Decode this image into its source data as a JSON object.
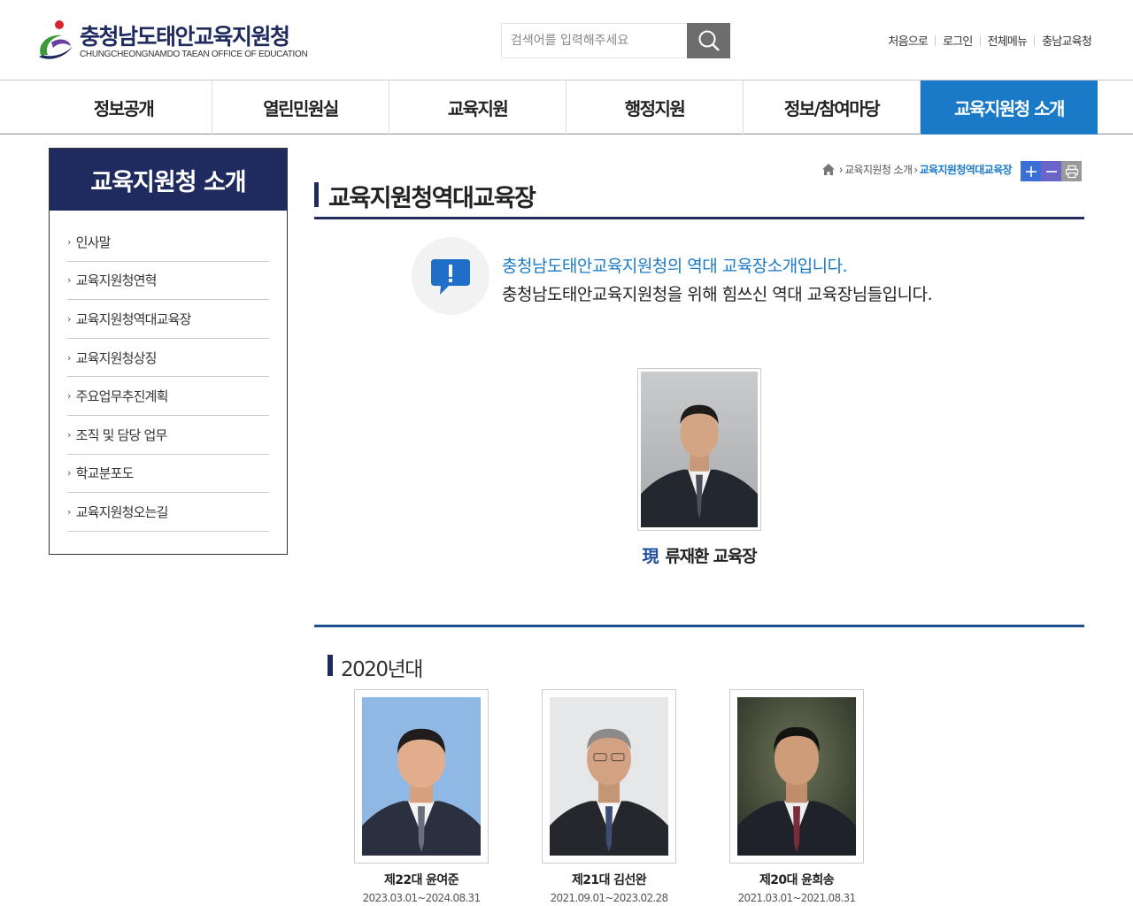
{
  "header": {
    "logo_title": "충청남도태안교육지원청",
    "logo_subtitle": "CHUNGCHEONGNAMDO TAEAN OFFICE OF EDUCATION",
    "search_placeholder": "검색어를 입력해주세요",
    "util_links": [
      "처음으로",
      "로그인",
      "전체메뉴",
      "충남교육청"
    ]
  },
  "gnb": {
    "items": [
      "정보공개",
      "열린민원실",
      "교육지원",
      "행정지원",
      "정보/참여마당",
      "교육지원청 소개"
    ],
    "active_index": 5
  },
  "sidebar": {
    "title": "교육지원청 소개",
    "items": [
      "인사말",
      "교육지원청연혁",
      "교육지원청역대교육장",
      "교육지원청상징",
      "주요업무추진계획",
      "조직 및 담당 업무",
      "학교분포도",
      "교육지원청오는길"
    ]
  },
  "breadcrumb": {
    "items": [
      "교육지원청 소개",
      "교육지원청역대교육장"
    ]
  },
  "page": {
    "title": "교육지원청역대교육장",
    "intro_line1": "충청남도태안교육지원청의 역대 교육장소개입니다.",
    "intro_line2": "충청남도태안교육지원청을 위해 힘쓰신 역대 교육장님들입니다."
  },
  "current": {
    "prefix": "現",
    "name": "류재환 교육장"
  },
  "decade": {
    "title": "2020년대",
    "people": [
      {
        "name": "제22대 윤여준",
        "term": "2023.03.01~2024.08.31"
      },
      {
        "name": "제21대 김선완",
        "term": "2021.09.01~2023.02.28"
      },
      {
        "name": "제20대 윤희송",
        "term": "2021.03.01~2021.08.31"
      }
    ]
  },
  "colors": {
    "navy": "#1f2a5e",
    "accent_blue": "#1a7ac8"
  }
}
